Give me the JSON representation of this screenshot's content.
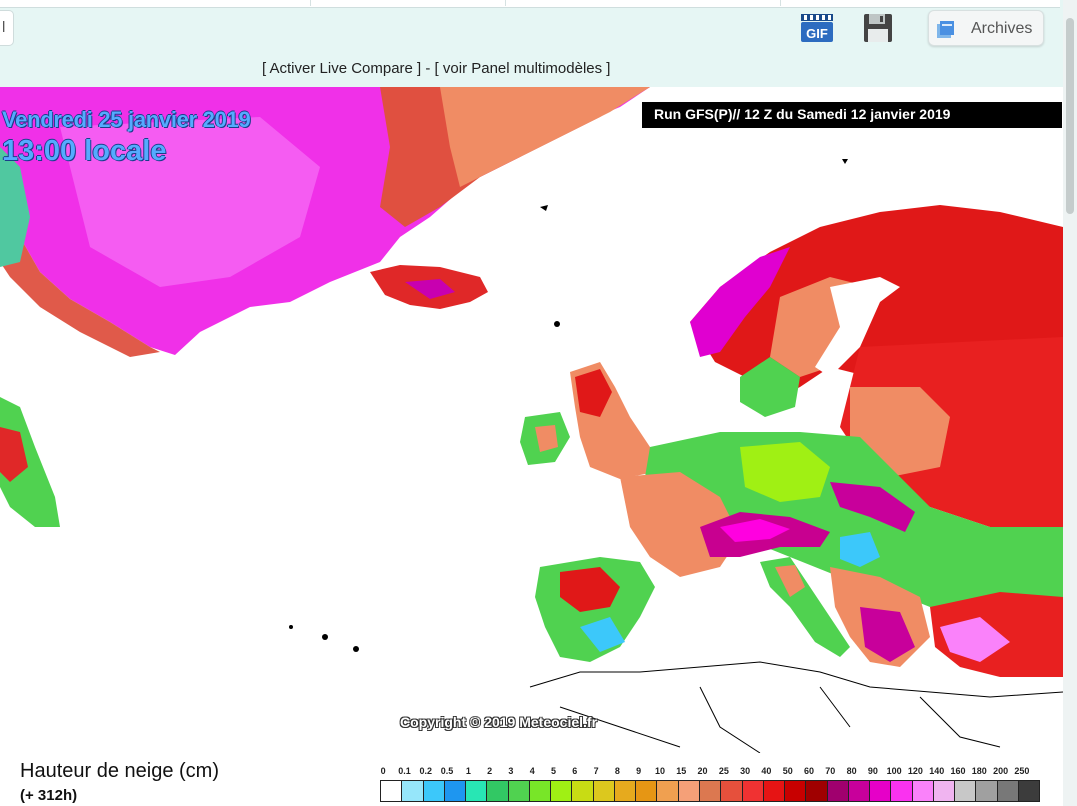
{
  "toolbar": {
    "left_button_label": "l",
    "gif_label": "GIF",
    "archives_label": "Archives",
    "links_text": "[ Activer Live Compare ] - [ voir Panel multimodèles ]"
  },
  "map": {
    "date_label": "Vendredi 25 janvier 2019",
    "time_label": "13:00 locale",
    "run_label": "Run GFS(P)// 12 Z du Samedi 12 janvier 2019",
    "copyright": "Copyright © 2019 Meteociel.fr"
  },
  "legend": {
    "title": "Hauteur de neige (cm)",
    "subtitle": "(+ 312h)",
    "labels": [
      "0",
      "0.1",
      "0.2",
      "0.5",
      "1",
      "2",
      "3",
      "4",
      "5",
      "6",
      "7",
      "8",
      "9",
      "10",
      "15",
      "20",
      "25",
      "30",
      "40",
      "50",
      "60",
      "70",
      "80",
      "90",
      "100",
      "120",
      "140",
      "160",
      "180",
      "200",
      "250"
    ],
    "colors": [
      "#ffffff",
      "#96e6fa",
      "#3cc8fa",
      "#1e96f0",
      "#28e6b4",
      "#32c864",
      "#50d250",
      "#78e628",
      "#a0f014",
      "#c8dc14",
      "#dcc81e",
      "#e6aa1e",
      "#e69614",
      "#f0a050",
      "#f5a078",
      "#dc7850",
      "#e6503c",
      "#f03232",
      "#e61414",
      "#c80000",
      "#a00000",
      "#a0006e",
      "#c8009b",
      "#e600c8",
      "#fa32f0",
      "#fa82fa",
      "#f0b4f0",
      "#c8c8c8",
      "#a0a0a0",
      "#787878",
      "#3c3c3c"
    ]
  },
  "colors": {
    "greenland": "#f020f0",
    "greenland_light": "#fa82fa",
    "land_dark_red": "#e01818",
    "land_salmon": "#f08c64",
    "land_green": "#50d250",
    "land_cyan": "#3cc8fa",
    "ocean": "#ffffff"
  }
}
